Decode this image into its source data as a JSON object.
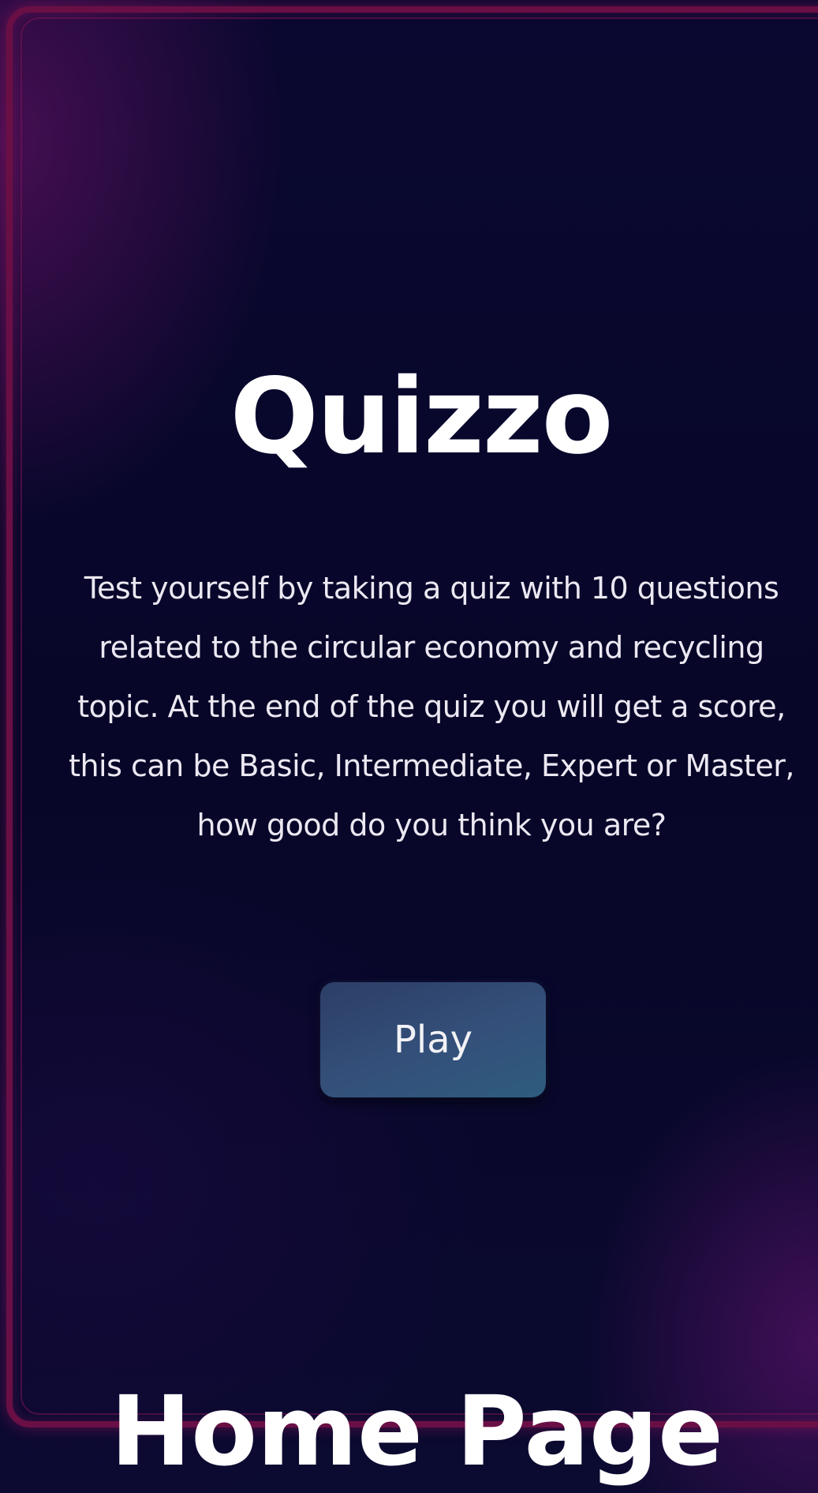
{
  "app": {
    "title": "Quizzo",
    "description": "Test yourself by taking a quiz with 10 questions related to the circular economy and recycling topic. At the end of the quiz you will get a score, this can be Basic, Intermediate, Expert or Master, how good do you think you are?",
    "play_label": "Play"
  },
  "caption": "Home Page",
  "colors": {
    "background": "#0a0726",
    "frame": "#6a0f45",
    "button": "#34507a",
    "text": "#ffffff"
  }
}
